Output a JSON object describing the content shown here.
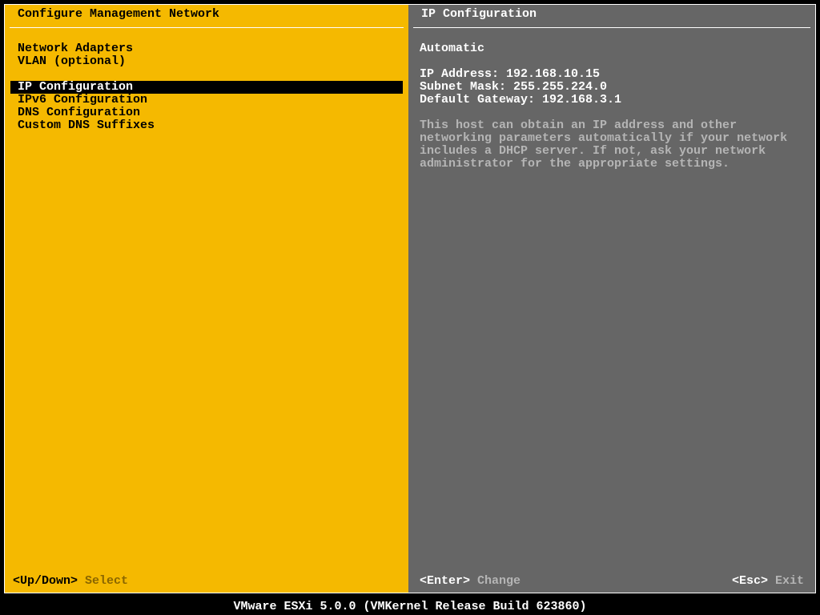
{
  "left": {
    "title": "Configure Management Network",
    "groups": [
      [
        "Network Adapters",
        "VLAN (optional)"
      ],
      [
        "IP Configuration",
        "IPv6 Configuration",
        "DNS Configuration",
        "Custom DNS Suffixes"
      ]
    ],
    "selected": "IP Configuration",
    "footer": {
      "keys": "<Up/Down>",
      "label": "Select"
    }
  },
  "right": {
    "title": "IP Configuration",
    "mode": "Automatic",
    "kv": [
      {
        "k": "IP Address",
        "v": "192.168.10.15"
      },
      {
        "k": "Subnet Mask",
        "v": "255.255.224.0"
      },
      {
        "k": "Default Gateway",
        "v": "192.168.3.1"
      }
    ],
    "help": "This host can obtain an IP address and other networking parameters automatically if your network includes a DHCP server. If not, ask your network administrator for the appropriate settings.",
    "footer": {
      "enter": {
        "keys": "<Enter>",
        "label": "Change"
      },
      "esc": {
        "keys": "<Esc>",
        "label": "Exit"
      }
    }
  },
  "status": "VMware ESXi 5.0.0 (VMKernel Release Build 623860)"
}
